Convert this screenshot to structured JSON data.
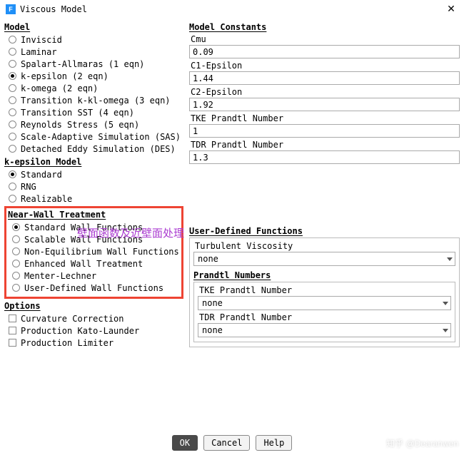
{
  "window": {
    "title": "Viscous Model",
    "icon_letter": "F"
  },
  "model": {
    "title": "Model",
    "options": [
      "Inviscid",
      "Laminar",
      "Spalart-Allmaras (1 eqn)",
      "k-epsilon (2 eqn)",
      "k-omega (2 eqn)",
      "Transition k-kl-omega (3 eqn)",
      "Transition SST (4 eqn)",
      "Reynolds Stress (5 eqn)",
      "Scale-Adaptive Simulation (SAS)",
      "Detached Eddy Simulation (DES)"
    ],
    "selected_index": 3
  },
  "ke_model": {
    "title": "k-epsilon Model",
    "options": [
      "Standard",
      "RNG",
      "Realizable"
    ],
    "selected_index": 0
  },
  "near_wall": {
    "title": "Near-Wall Treatment",
    "options": [
      "Standard Wall Functions",
      "Scalable Wall Functions",
      "Non-Equilibrium Wall Functions",
      "Enhanced Wall Treatment",
      "Menter-Lechner",
      "User-Defined Wall Functions"
    ],
    "selected_index": 0
  },
  "options_group": {
    "title": "Options",
    "items": [
      {
        "label": "Curvature Correction",
        "checked": false
      },
      {
        "label": "Production Kato-Launder",
        "checked": false
      },
      {
        "label": "Production Limiter",
        "checked": false
      }
    ]
  },
  "constants": {
    "title": "Model Constants",
    "fields": [
      {
        "label": "Cmu",
        "value": "0.09"
      },
      {
        "label": "C1-Epsilon",
        "value": "1.44"
      },
      {
        "label": "C2-Epsilon",
        "value": "1.92"
      },
      {
        "label": "TKE Prandtl Number",
        "value": "1"
      },
      {
        "label": "TDR Prandtl Number",
        "value": "1.3"
      }
    ]
  },
  "udf": {
    "title": "User-Defined Functions",
    "turb_visc": {
      "label": "Turbulent Viscosity",
      "value": "none"
    },
    "prandtl": {
      "title": "Prandtl Numbers",
      "items": [
        {
          "label": "TKE Prandtl Number",
          "value": "none"
        },
        {
          "label": "TDR Prandtl Number",
          "value": "none"
        }
      ]
    }
  },
  "annotation": "壁面函数及近壁面处理",
  "buttons": {
    "ok": "OK",
    "cancel": "Cancel",
    "help": "Help"
  },
  "watermark": "知乎 @Dearanwen"
}
